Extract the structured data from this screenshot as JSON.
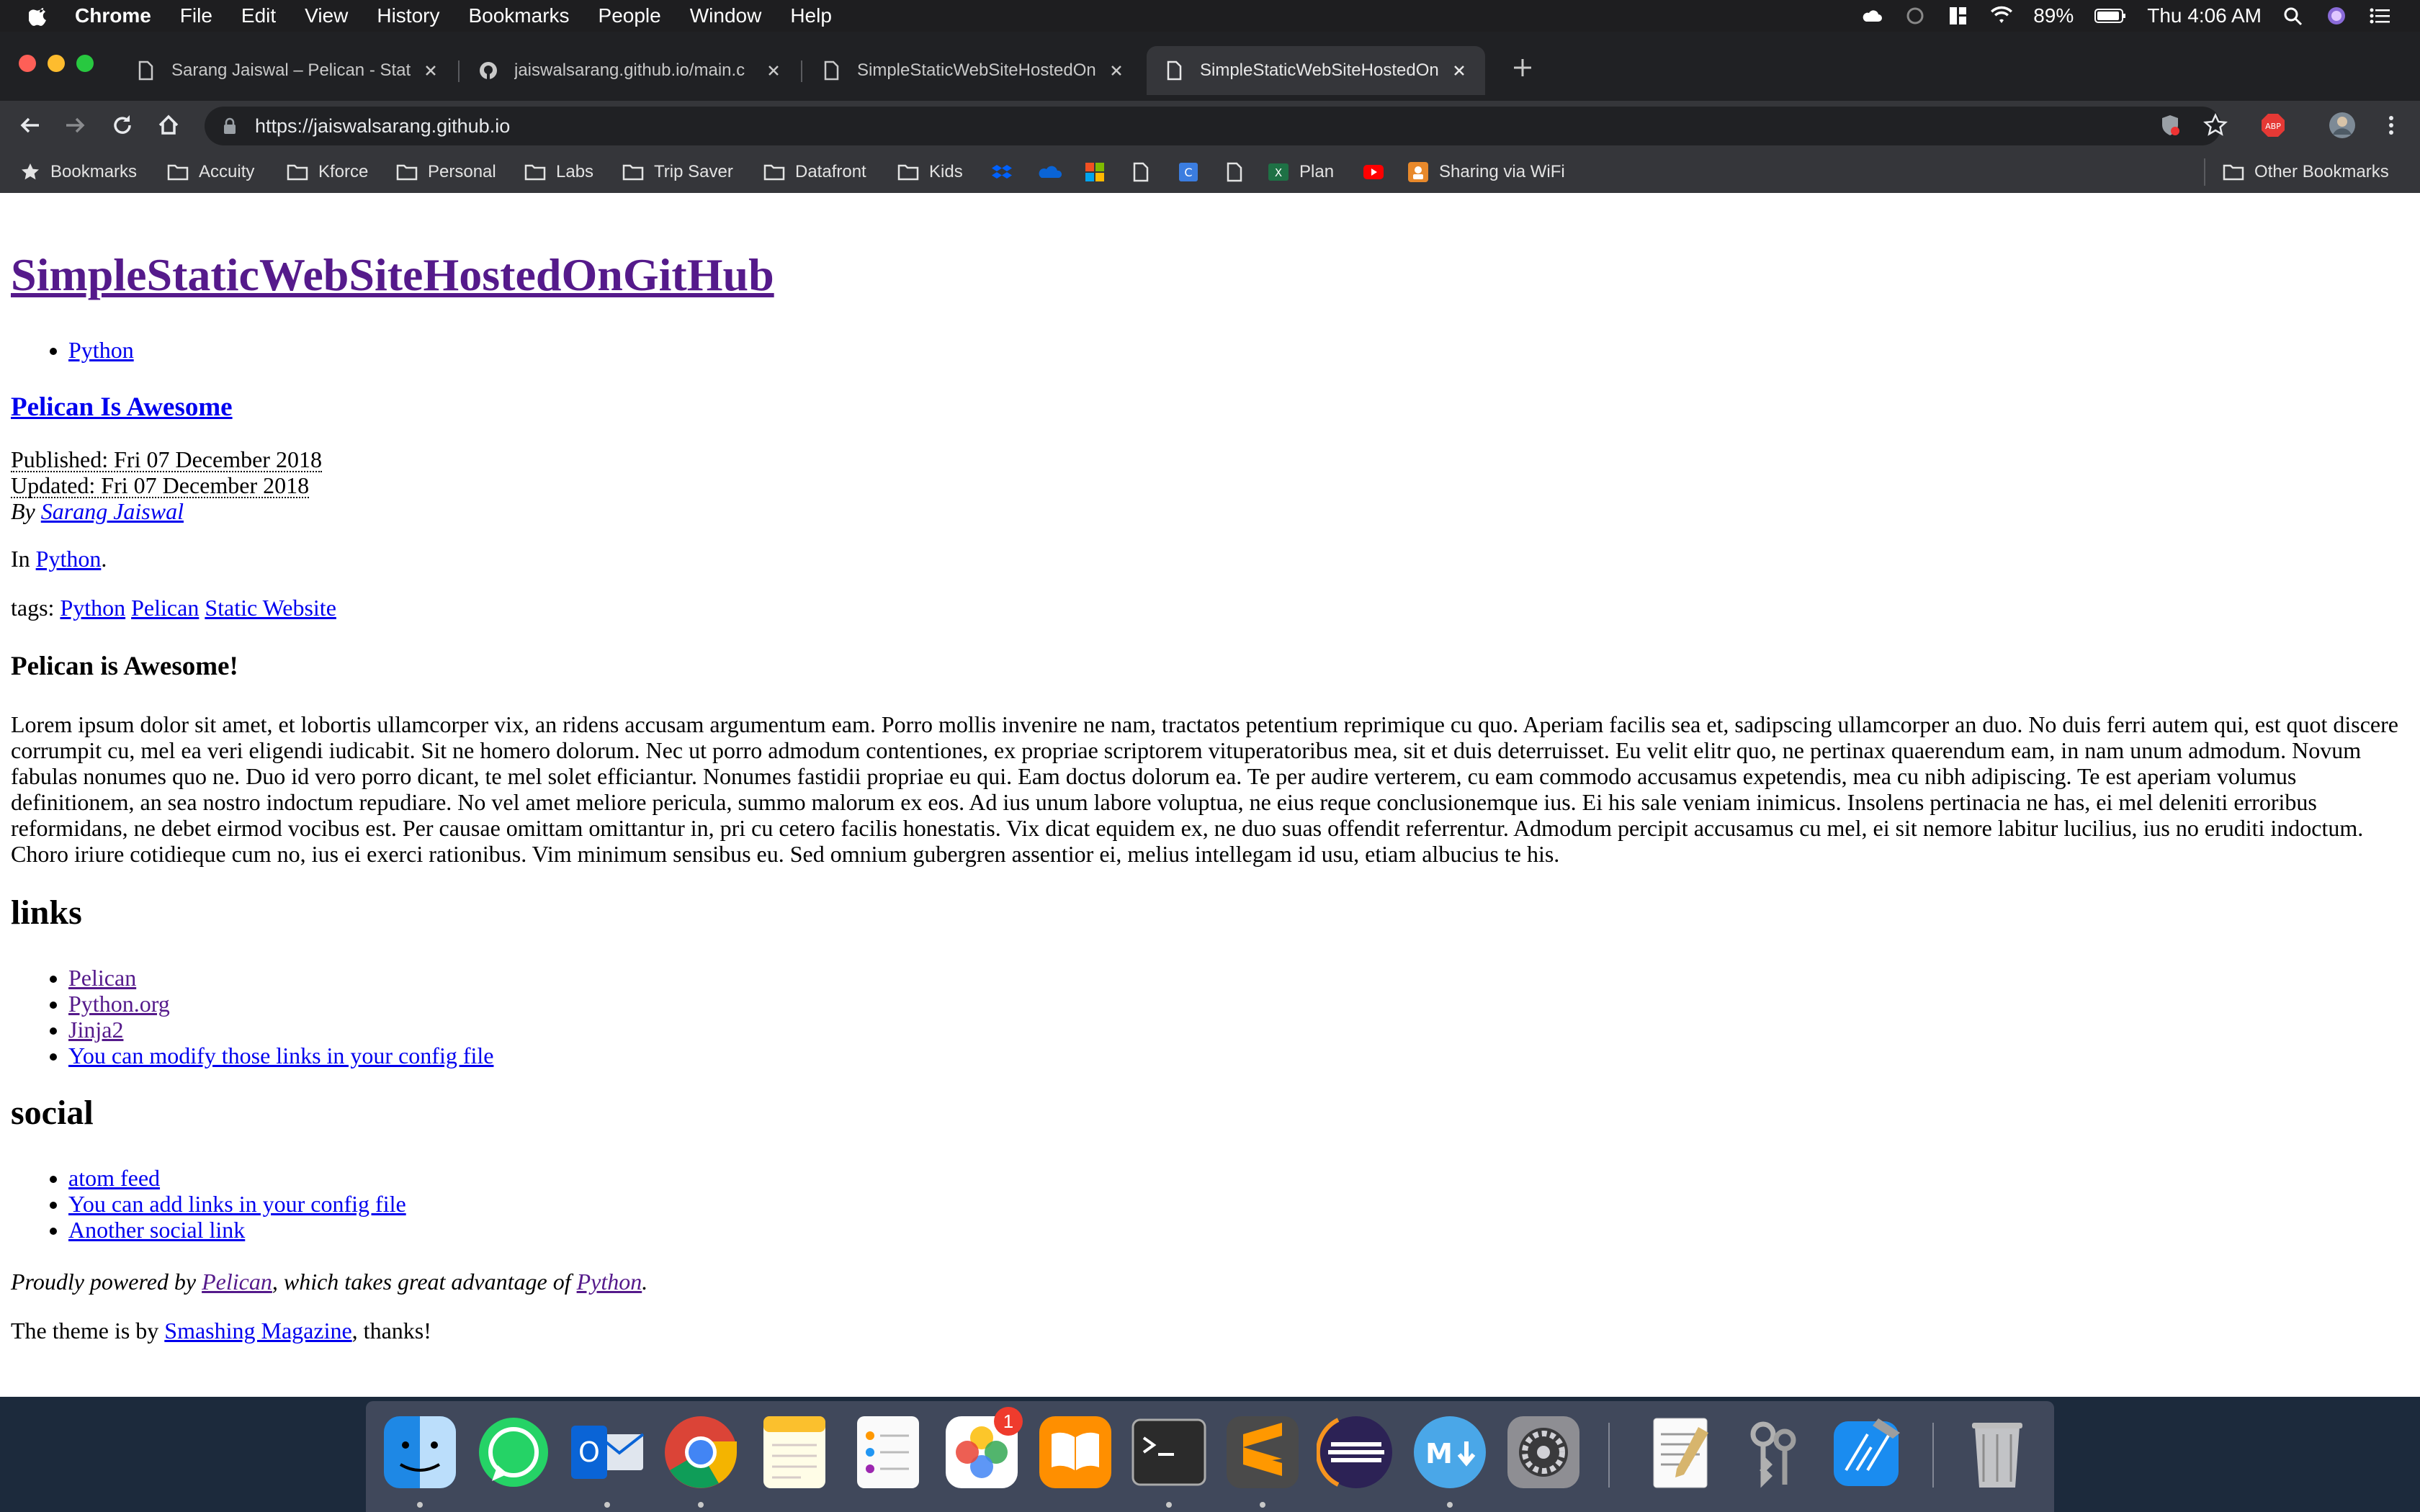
{
  "menubar": {
    "app": "Chrome",
    "items": [
      "File",
      "Edit",
      "View",
      "History",
      "Bookmarks",
      "People",
      "Window",
      "Help"
    ],
    "battery": "89%",
    "clock": "Thu 4:06 AM"
  },
  "tabs": [
    {
      "label": "Sarang Jaiswal – Pelican - Stat",
      "icon": "document-icon"
    },
    {
      "label": "jaiswalsarang.github.io/main.c",
      "icon": "github-icon"
    },
    {
      "label": "SimpleStaticWebSiteHostedOn",
      "icon": "document-icon"
    },
    {
      "label": "SimpleStaticWebSiteHostedOn",
      "icon": "document-icon"
    }
  ],
  "address_bar": {
    "url": "https://jaiswalsarang.github.io"
  },
  "bookmarks": {
    "items": [
      "Bookmarks",
      "Accuity",
      "Kforce",
      "Personal",
      "Labs",
      "Trip Saver",
      "Datafront",
      "Kids",
      "Plan",
      "Sharing via WiFi"
    ],
    "other": "Other Bookmarks"
  },
  "page": {
    "site_title": "SimpleStaticWebSiteHostedOnGitHub",
    "nav": [
      "Python"
    ],
    "article_title": "Pelican Is Awesome",
    "published": "Published: Fri 07 December 2018",
    "updated": "Updated: Fri 07 December 2018",
    "by_prefix": "By",
    "author": "Sarang Jaiswal",
    "in_prefix": "In",
    "category": "Python",
    "in_suffix": ".",
    "tags_prefix": "tags:",
    "tags": [
      "Python",
      "Pelican",
      "Static Website"
    ],
    "heading": "Pelican is Awesome!",
    "body": "Lorem ipsum dolor sit amet, et lobortis ullamcorper vix, an ridens accusam argumentum eam. Porro mollis invenire ne nam, tractatos petentium reprimique cu quo. Aperiam facilis sea et, sadipscing ullamcorper an duo. No duis ferri autem qui, est quot discere corrumpit cu, mel ea veri eligendi iudicabit. Sit ne homero dolorum. Nec ut porro admodum contentiones, ex propriae scriptorem vituperatoribus mea, sit et duis deterruisset. Eu velit elitr quo, ne pertinax quaerendum eam, in nam unum admodum. Novum fabulas nonumes quo ne. Duo id vero porro dicant, te mel solet efficiantur. Nonumes fastidii propriae eu qui. Eam doctus dolorum ea. Te per audire verterem, cu eam commodo accusamus expetendis, mea cu nibh adipiscing. Te est aperiam volumus definitionem, an sea nostro indoctum repudiare. No vel amet meliore pericula, summo malorum ex eos. Ad ius unum labore voluptua, ne eius reque conclusionemque ius. Ei his sale veniam inimicus. Insolens pertinacia ne has, ei mel deleniti erroribus reformidans, ne debet eirmod vocibus est. Per causae omittam omittantur in, pri cu cetero facilis honestatis. Vix dicat equidem ex, ne duo suas offendit referrentur. Admodum percipit accusamus cu mel, ei sit nemore labitur lucilius, ius no eruditi indoctum. Choro iriure cotidieque cum no, ius ei exerci rationibus. Vim minimum sensibus eu. Sed omnium gubergren assentior ei, melius intellegam id usu, etiam albucius te his.",
    "links_heading": "links",
    "links": [
      "Pelican",
      "Python.org",
      "Jinja2",
      "You can modify those links in your config file"
    ],
    "social_heading": "social",
    "social": [
      "atom feed",
      "You can add links in your config file",
      "Another social link"
    ],
    "footer1_prefix": "Proudly powered by",
    "footer1_link1": "Pelican",
    "footer1_mid": ", which takes great advantage of",
    "footer1_link2": "Python",
    "footer1_suffix": ".",
    "footer2_prefix": "The theme is by",
    "footer2_link": "Smashing Magazine",
    "footer2_suffix": ", thanks!"
  },
  "dock": {
    "apps": [
      "finder",
      "whatsapp",
      "outlook",
      "chrome",
      "notes",
      "reminders",
      "photos",
      "books",
      "terminal",
      "sublime-text",
      "eclipse",
      "markdown",
      "system-preferences",
      "textedit",
      "keychain",
      "xcode",
      "trash"
    ],
    "photos_badge": "1"
  }
}
